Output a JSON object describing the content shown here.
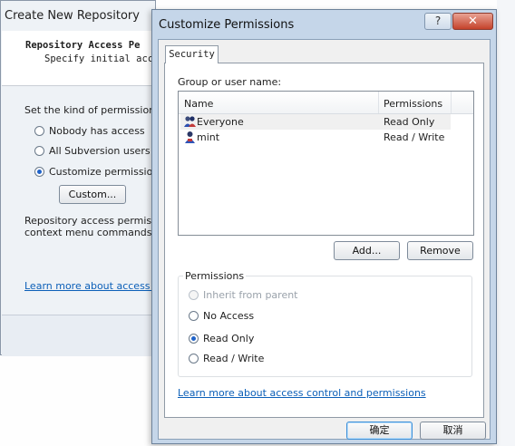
{
  "background_dialog": {
    "title": "Create New Repository",
    "header_line1": "Repository Access Pe",
    "header_line2": "Specify initial acc",
    "prompt": "Set the kind of permissions yo",
    "options": [
      {
        "label": "Nobody has access",
        "selected": false
      },
      {
        "label": "All Subversion users hav",
        "selected": false
      },
      {
        "label": "Customize permissions",
        "selected": true
      }
    ],
    "custom_button": "Custom...",
    "desc_line1": "Repository access permission",
    "desc_line2": "context menu commands for",
    "link": "Learn more about access cont"
  },
  "dialog": {
    "title": "Customize Permissions",
    "help_glyph": "?",
    "close_glyph": "✕",
    "tab": "Security",
    "group_label": "Group or user name:",
    "columns": [
      "Name",
      "Permissions"
    ],
    "users": [
      {
        "name": "Everyone",
        "permission": "Read Only",
        "selected": true,
        "icon": "users-group-icon"
      },
      {
        "name": "mint",
        "permission": "Read / Write",
        "selected": false,
        "icon": "user-icon"
      }
    ],
    "add_button": "Add...",
    "remove_button": "Remove",
    "permissions_label": "Permissions",
    "permission_options": [
      {
        "label": "Inherit from parent",
        "selected": false,
        "disabled": true
      },
      {
        "label": "No Access",
        "selected": false,
        "disabled": false
      },
      {
        "label": "Read Only",
        "selected": true,
        "disabled": false
      },
      {
        "label": "Read / Write",
        "selected": false,
        "disabled": false
      }
    ],
    "link": "Learn more about access control and permissions",
    "ok_button": "确定",
    "cancel_button": "取消"
  },
  "colors": {
    "link": "#0b5fb8",
    "selection_radio": "#1f63c9",
    "close_button": "#c4422b"
  }
}
